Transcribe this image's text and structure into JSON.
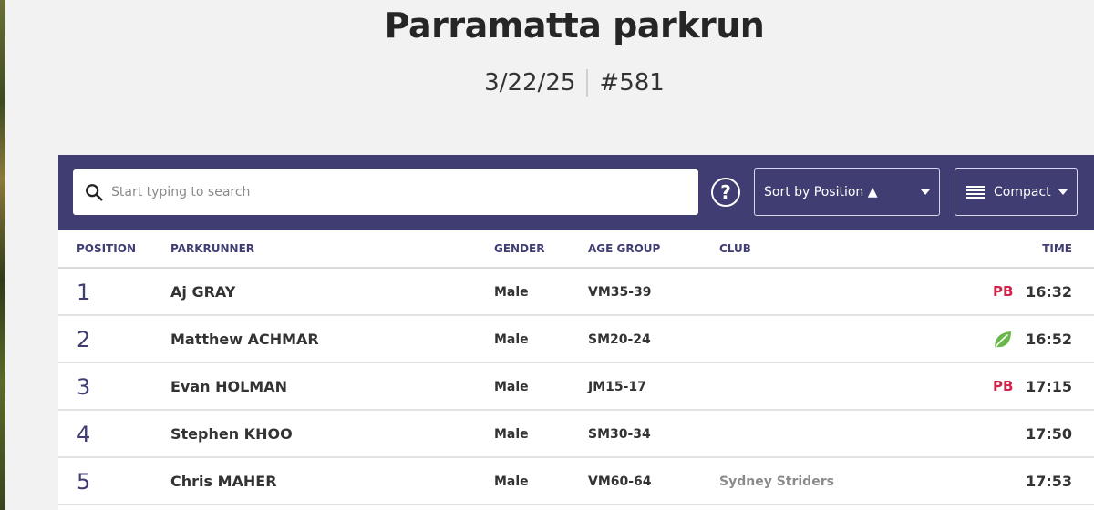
{
  "event": {
    "title": "Parramatta parkrun",
    "date": "3/22/25",
    "number": "#581"
  },
  "toolbar": {
    "search_placeholder": "Start typing to search",
    "help_label": "?",
    "sort_label": "Sort by Position ▲",
    "view_label": "Compact"
  },
  "columns": {
    "position": "POSITION",
    "parkrunner": "PARKRUNNER",
    "gender": "GENDER",
    "age_group": "AGE GROUP",
    "club": "CLUB",
    "time": "TIME"
  },
  "rows": [
    {
      "position": "1",
      "name": "Aj GRAY",
      "gender": "Male",
      "age_group": "VM35-39",
      "club": "",
      "badge": "PB",
      "time": "16:32"
    },
    {
      "position": "2",
      "name": "Matthew ACHMAR",
      "gender": "Male",
      "age_group": "SM20-24",
      "club": "",
      "badge": "first-timer-leaf-icon",
      "time": "16:52"
    },
    {
      "position": "3",
      "name": "Evan HOLMAN",
      "gender": "Male",
      "age_group": "JM15-17",
      "club": "",
      "badge": "PB",
      "time": "17:15"
    },
    {
      "position": "4",
      "name": "Stephen KHOO",
      "gender": "Male",
      "age_group": "SM30-34",
      "club": "",
      "badge": "",
      "time": "17:50"
    },
    {
      "position": "5",
      "name": "Chris MAHER",
      "gender": "Male",
      "age_group": "VM60-64",
      "club": "Sydney Striders",
      "badge": "",
      "time": "17:53"
    }
  ],
  "colors": {
    "toolbar_bg": "#3f3d72",
    "pb_red": "#d0234c",
    "leaf_green": "#6bb84a"
  }
}
